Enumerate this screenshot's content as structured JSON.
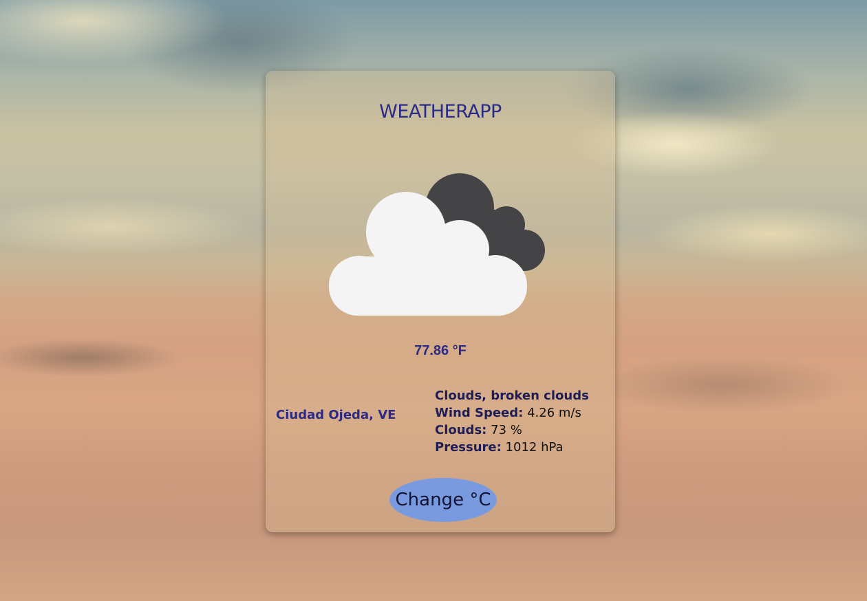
{
  "app": {
    "title": "WEATHERAPP"
  },
  "weather": {
    "icon": "broken-clouds-icon",
    "temperature": "77.86 °F",
    "location": "Ciudad Ojeda, VE",
    "description": "Clouds, broken clouds",
    "wind_speed_label": "Wind Speed:",
    "wind_speed_value": "4.26 m/s",
    "clouds_label": "Clouds:",
    "clouds_value": "73 %",
    "pressure_label": "Pressure:",
    "pressure_value": "1012 hPa"
  },
  "controls": {
    "change_unit_label": "Change °C"
  },
  "colors": {
    "title": "#2b2a86",
    "button": "#7a9ae0",
    "cloud_front": "#f4f4f4",
    "cloud_back": "#444446"
  }
}
